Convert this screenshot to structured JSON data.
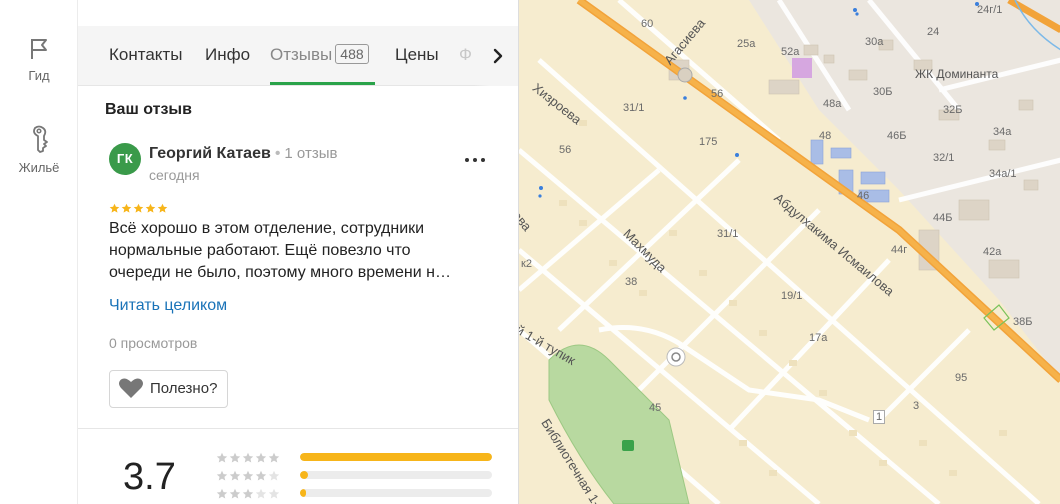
{
  "rail": {
    "guide_label": "Гид",
    "housing_label": "Жильё"
  },
  "tabs": [
    {
      "label": "Контакты"
    },
    {
      "label": "Инфо"
    },
    {
      "label": "Отзывы",
      "count": "488",
      "active": true
    },
    {
      "label": "Цены"
    },
    {
      "label": "Ф"
    }
  ],
  "review_section": {
    "title": "Ваш отзыв",
    "author": {
      "initials": "ГК",
      "name": "Георгий Катаев",
      "reviews_count": "1 отзыв",
      "date": "сегодня",
      "avatar_color": "#3a9a4a"
    },
    "stars": 5,
    "text_lines": [
      "Всё хорошо в этом отделение, сотрудники",
      "нормальные работают. Ещё повезло что",
      "очереди не было, поэтому много времени н…"
    ],
    "read_more": "Читать целиком",
    "views": "0 просмотров",
    "helpful_label": "Полезно?"
  },
  "rating_summary": {
    "value": "3.7",
    "rows": [
      {
        "stars": 5,
        "fraction": 1.0
      },
      {
        "stars": 4,
        "fraction": 0.04
      },
      {
        "stars": 3,
        "fraction": 0.03
      }
    ],
    "star_color": "#f7b51a",
    "empty_star_color": "#cccccc"
  },
  "map": {
    "street_labels": [
      "Хизроева",
      "Агасиева",
      "Абдулхакима Исмаилова",
      "Махмуда",
      "Библиотечная 1-я",
      "й 1-й тупик",
      "ЖК Доминанта",
      "ова",
      "к2"
    ],
    "house_numbers": [
      "60",
      "25а",
      "52а",
      "30а",
      "24",
      "24г/1",
      "56",
      "30Б",
      "32Б",
      "31/1",
      "48а",
      "175",
      "46Б",
      "34а",
      "56",
      "48",
      "32/1",
      "34а/1",
      "46",
      "44Б",
      "31/1",
      "44г",
      "42а",
      "38",
      "19/1",
      "38Б",
      "17а",
      "95",
      "45",
      "3",
      "1"
    ]
  }
}
